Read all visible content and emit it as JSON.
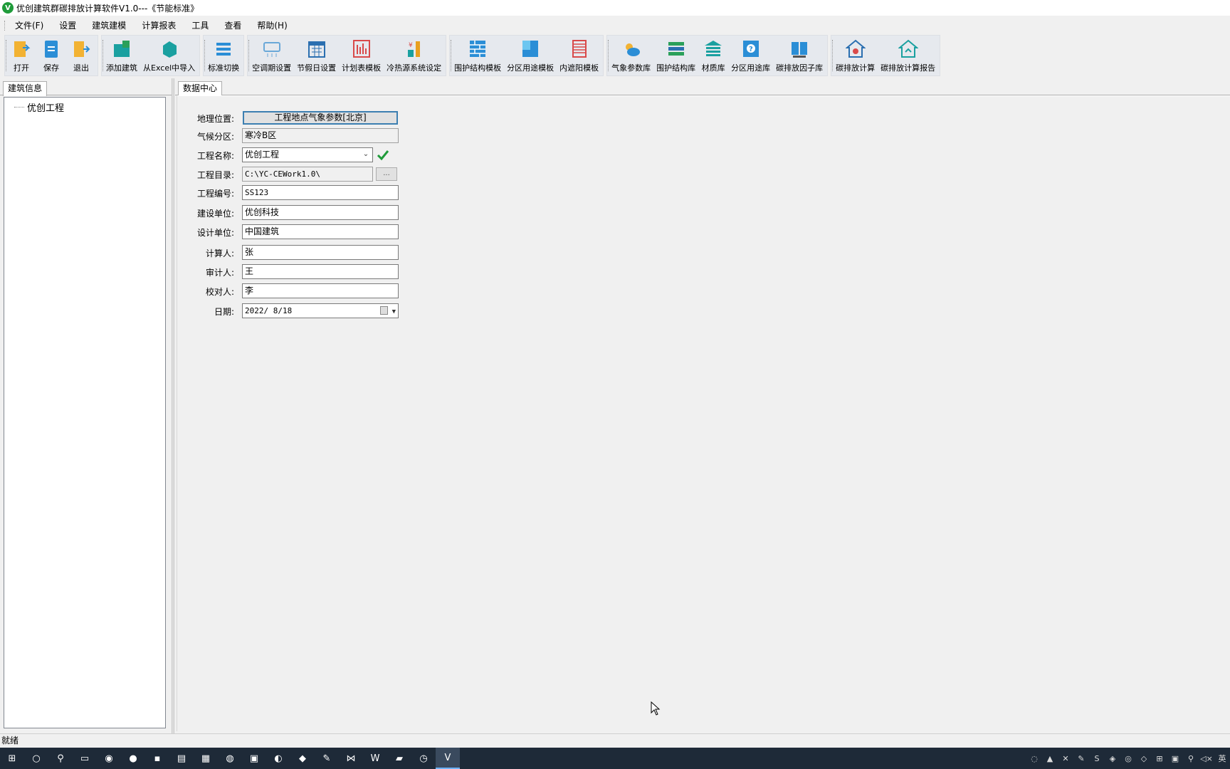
{
  "window": {
    "title": "优创建筑群碳排放计算软件V1.0---《节能标准》",
    "app_icon_letter": "V"
  },
  "menubar": {
    "items": [
      "文件(F)",
      "设置",
      "建筑建模",
      "计算报表",
      "工具",
      "查看",
      "帮助(H)"
    ]
  },
  "toolbar": {
    "groups": [
      [
        {
          "label": "打开",
          "icon": "open-folder-icon",
          "color": "#f2b233"
        },
        {
          "label": "保存",
          "icon": "save-document-icon",
          "color": "#2b8ed6"
        },
        {
          "label": "退出",
          "icon": "exit-door-icon",
          "color": "#f2b233"
        }
      ],
      [
        {
          "label": "添加建筑",
          "icon": "add-building-icon",
          "color": "#1aa0a0"
        },
        {
          "label": "从Excel中导入",
          "icon": "excel-import-icon",
          "color": "#1aa0a0"
        }
      ],
      [
        {
          "label": "标准切换",
          "icon": "standard-switch-icon",
          "color": "#2b8ed6"
        }
      ],
      [
        {
          "label": "空调期设置",
          "icon": "ac-period-icon",
          "color": "#6aa8d8"
        },
        {
          "label": "节假日设置",
          "icon": "holiday-calendar-icon",
          "color": "#2b6fb0"
        },
        {
          "label": "计划表模板",
          "icon": "schedule-chart-icon",
          "color": "#d94a4a"
        },
        {
          "label": "冷热源系统设定",
          "icon": "heat-source-icon",
          "color": "#e8a020"
        }
      ],
      [
        {
          "label": "围护结构模板",
          "icon": "envelope-wall-icon",
          "color": "#2b8ed6"
        },
        {
          "label": "分区用途模板",
          "icon": "zone-usage-icon",
          "color": "#2b8ed6"
        },
        {
          "label": "内遮阳模板",
          "icon": "inner-shade-icon",
          "color": "#d94a4a"
        }
      ],
      [
        {
          "label": "气象参数库",
          "icon": "weather-cloud-icon",
          "color": "#2b8ed6"
        },
        {
          "label": "围护结构库",
          "icon": "envelope-library-icon",
          "color": "#2ba05a"
        },
        {
          "label": "材质库",
          "icon": "material-library-icon",
          "color": "#1aa0a0"
        },
        {
          "label": "分区用途库",
          "icon": "zone-library-icon",
          "color": "#2b8ed6"
        },
        {
          "label": "碳排放因子库",
          "icon": "carbon-factor-icon",
          "color": "#2b8ed6"
        }
      ],
      [
        {
          "label": "碳排放计算",
          "icon": "carbon-calc-house-icon",
          "color": "#2b6fb0"
        },
        {
          "label": "碳排放计算报告",
          "icon": "carbon-report-house-icon",
          "color": "#1aa0a0"
        }
      ]
    ]
  },
  "left_panel": {
    "tab": "建筑信息",
    "tree_root": "优创工程"
  },
  "main": {
    "tab": "数据中心",
    "form": {
      "geo_label": "地理位置:",
      "geo_button": "工程地点气象参数[北京]",
      "climate_label": "气候分区:",
      "climate_value": "寒冷B区",
      "project_name_label": "工程名称:",
      "project_name_value": "优创工程",
      "project_dir_label": "工程目录:",
      "project_dir_value": "C:\\YC-CEWork1.0\\",
      "browse_label": "...",
      "project_no_label": "工程编号:",
      "project_no_value": "SS123",
      "builder_label": "建设单位:",
      "builder_value": "优创科技",
      "designer_label": "设计单位:",
      "designer_value": "中国建筑",
      "calculator_label": "计算人:",
      "calculator_value": "张",
      "reviewer_label": "审计人:",
      "reviewer_value": "王",
      "checker_label": "校对人:",
      "checker_value": "李",
      "date_label": "日期:",
      "date_value": "2022/ 8/18"
    }
  },
  "statusbar": {
    "text": "就绪"
  },
  "taskbar": {
    "icons": [
      "windows-start-icon",
      "cortana-circle-icon",
      "search-icon",
      "file-explorer-icon",
      "chrome-icon",
      "firefox-icon",
      "sticky-notes-icon",
      "network-icon",
      "notepad-icon",
      "wechat-icon",
      "save-app-icon",
      "edge-icon",
      "app-icon",
      "tool-icon",
      "visual-studio-icon",
      "word-icon",
      "pdf-icon",
      "clock-icon",
      "yc-app-icon"
    ],
    "tray": [
      "tray-app-1-icon",
      "nvidia-icon",
      "close-tray-icon",
      "pen-icon",
      "sogou-icon",
      "shield-icon",
      "updater-icon",
      "defender-icon",
      "windows-tray-icon",
      "save-tray-icon",
      "search-tray-icon",
      "volume-mute-icon",
      "ime-icon"
    ]
  }
}
